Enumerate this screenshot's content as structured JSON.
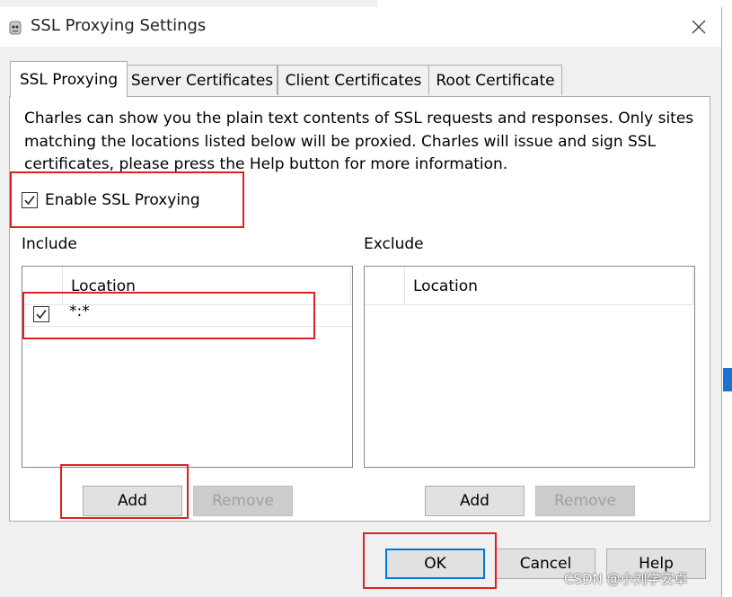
{
  "window": {
    "title": "SSL Proxying Settings"
  },
  "tabs": [
    {
      "label": "SSL Proxying",
      "active": true
    },
    {
      "label": "Server Certificates",
      "active": false
    },
    {
      "label": "Client Certificates",
      "active": false
    },
    {
      "label": "Root Certificate",
      "active": false
    }
  ],
  "description": "Charles can show you the plain text contents of SSL requests and responses. Only sites matching the locations listed below will be proxied. Charles will issue and sign SSL certificates, please press the Help button for more information.",
  "enable": {
    "label": "Enable SSL Proxying",
    "checked": true
  },
  "include": {
    "label": "Include",
    "column": "Location",
    "rows": [
      {
        "checked": true,
        "location": "*:*"
      }
    ],
    "add_label": "Add",
    "remove_label": "Remove"
  },
  "exclude": {
    "label": "Exclude",
    "column": "Location",
    "add_label": "Add",
    "remove_label": "Remove"
  },
  "buttons": {
    "ok": "OK",
    "cancel": "Cancel",
    "help": "Help"
  },
  "watermark": "CSDN @小刘学安卓",
  "colors": {
    "highlight": "#e02020",
    "focus": "#0078d7"
  }
}
